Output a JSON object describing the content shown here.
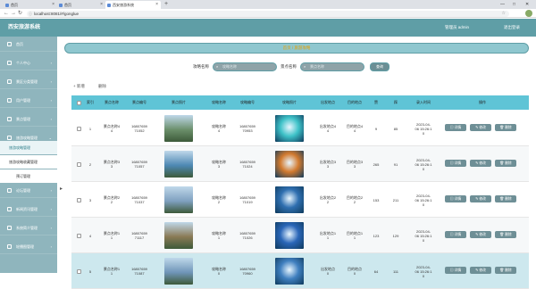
{
  "browser": {
    "tabs": [
      "首页",
      "首页",
      "西安旅游系统"
    ],
    "url": "localhost:8081/#/gonglue",
    "controls": [
      "—",
      "□",
      "✕"
    ]
  },
  "app": {
    "title": "西安旅游系统",
    "user": "管理员 admin",
    "logout": "退出登录"
  },
  "sidebar": {
    "items": [
      "首页",
      "个人中心",
      "景区分类管理",
      "用户管理",
      "景点管理",
      "旅游攻略管理",
      "论坛管理",
      "新闻资讯管理",
      "系统简介管理",
      "轮播图管理"
    ],
    "sub_items": [
      "旅游攻略管理",
      "旅游攻略收藏管理",
      "预订管理"
    ]
  },
  "breadcrumb": "首页 / 旅游攻略",
  "search": {
    "field1_label": "攻略名称",
    "field1_placeholder": "攻略名称",
    "field2_label": "景点名称",
    "field2_placeholder": "景点名称",
    "button": "查询"
  },
  "actions": {
    "add": "+ 新增",
    "delete": "删除"
  },
  "table": {
    "headers": [
      "",
      "索引",
      "景点名称",
      "景点编号",
      "景点照片",
      "攻略名称",
      "攻略编号",
      "攻略照片",
      "出发地点",
      "目的地点",
      "赞",
      "踩",
      "录入时间",
      "操作"
    ],
    "rows": [
      {
        "idx": "1",
        "scenic_name": "景点名称4\n4",
        "scenic_no": "16807659\n71052",
        "scenic_color": "#6b8f6a",
        "guide_name": "攻略名称\n4",
        "guide_no": "16807659\n70953",
        "guide_color": "#3ec2c8",
        "from": "出发地点4\n4",
        "to": "目的地点4\n4",
        "like": "9",
        "dislike": "85",
        "time": "2023-04-\n06 15:26:1\n0"
      },
      {
        "idx": "2",
        "scenic_name": "景点名称3\n3",
        "scenic_no": "16807659\n71057",
        "scenic_color": "#4d88b3",
        "guide_name": "攻略名称\n3",
        "guide_no": "16807659\n71024",
        "guide_color": "#d27a2e",
        "from": "出发地点3\n3",
        "to": "目的地点3\n3",
        "like": "265",
        "dislike": "91",
        "time": "2023-04-\n06 15:26:1\n0"
      },
      {
        "idx": "3",
        "scenic_name": "景点名称2\n2",
        "scenic_no": "16807659\n71037",
        "scenic_color": "#7fa0bf",
        "guide_name": "攻略名称\n2",
        "guide_no": "16807659\n71019",
        "guide_color": "#2f6fb0",
        "from": "出发地点2\n2",
        "to": "目的地点2\n2",
        "like": "153",
        "dislike": "211",
        "time": "2023-04-\n06 15:26:1\n0"
      },
      {
        "idx": "4",
        "scenic_name": "景点名称1\n1",
        "scenic_no": "16807659\n71117",
        "scenic_color": "#8a7a55",
        "guide_name": "攻略名称\n1",
        "guide_no": "16807659\n71026",
        "guide_color": "#2a66b8",
        "from": "出发地点1\n1",
        "to": "目的地点1\n1",
        "like": "123",
        "dislike": "129",
        "time": "2023-04-\n06 15:26:1\n0"
      },
      {
        "idx": "5",
        "scenic_name": "景点名称1\n1",
        "scenic_no": "16807659\n71087",
        "scenic_color": "#6f95b8",
        "guide_name": "攻略名称\n0",
        "guide_no": "16807659\n70960",
        "guide_color": "#3f7fbf",
        "from": "出发地点\n0",
        "to": "目的地点\n0",
        "like": "64",
        "dislike": "111",
        "time": "2023-04-\n06 15:26:1\n0"
      }
    ],
    "ops": [
      "详情",
      "修改",
      "删除"
    ]
  }
}
